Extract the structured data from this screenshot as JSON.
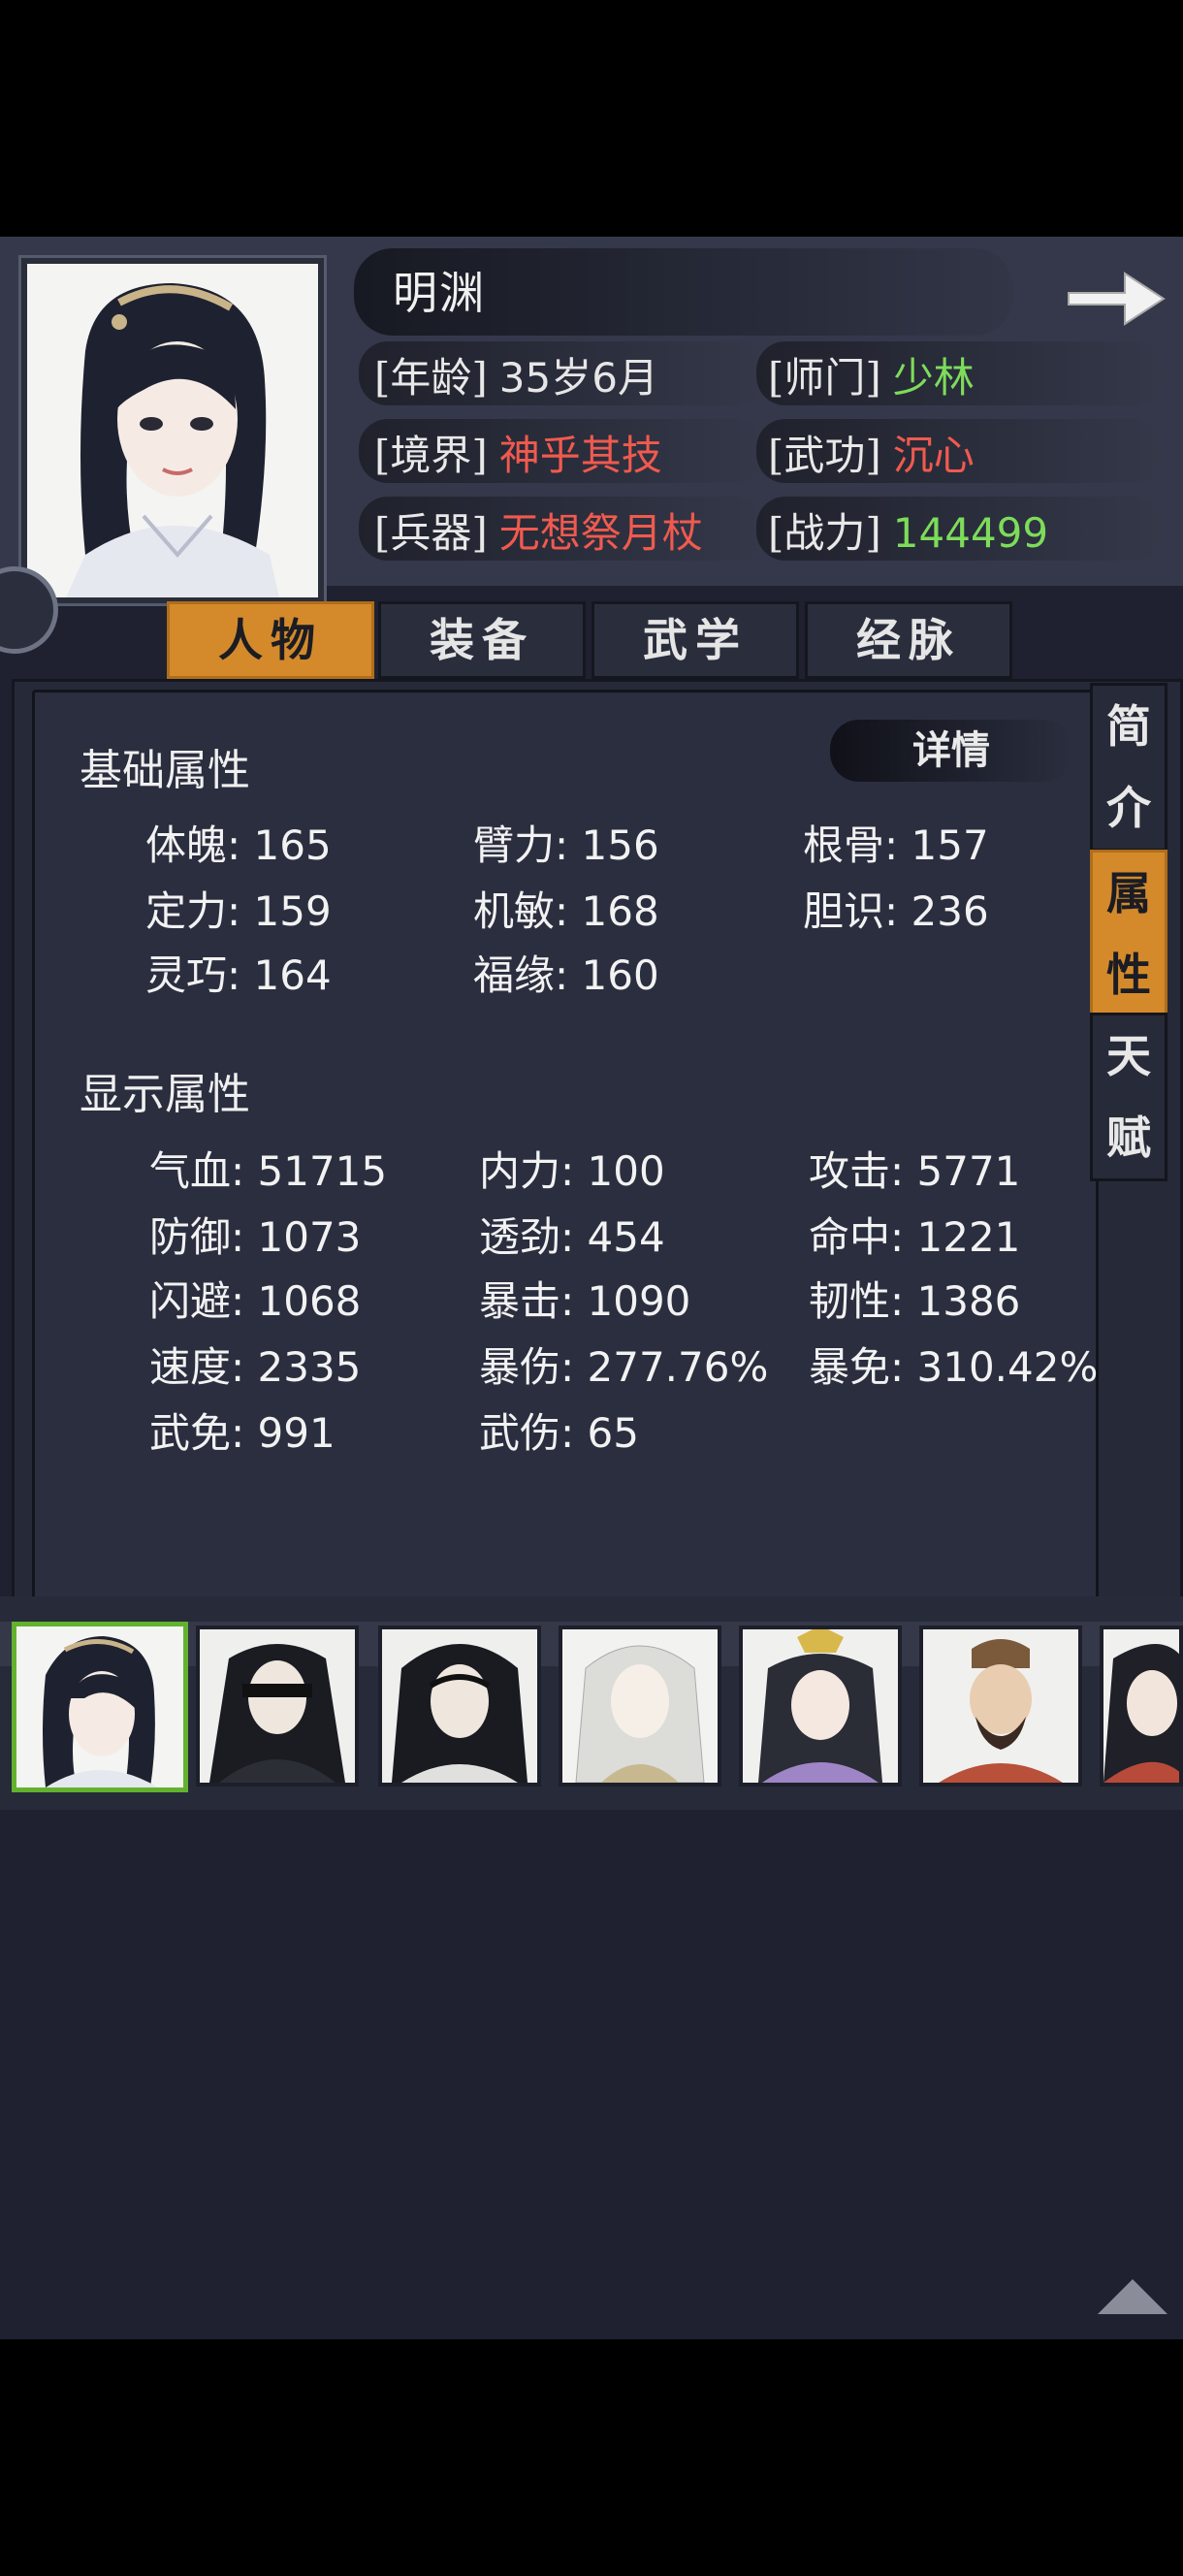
{
  "character": {
    "name": "明渊",
    "age_label": "[年龄]",
    "age_value": "35岁6月",
    "sect_label": "[师门]",
    "sect_value": "少林",
    "realm_label": "[境界]",
    "realm_value": "神乎其技",
    "martial_label": "[武功]",
    "martial_value": "沉心",
    "weapon_label": "[兵器]",
    "weapon_value": "无想祭月杖",
    "power_label": "[战力]",
    "power_value": "144499"
  },
  "colors": {
    "value_white": "#e6e6e6",
    "value_green": "#7ddc5a",
    "value_red": "#f05a4e",
    "accent_orange": "#d48a2a",
    "selected_border": "#63b22f"
  },
  "tabs": [
    "人物",
    "装备",
    "武学",
    "经脉"
  ],
  "active_tab": "人物",
  "side_tabs": [
    {
      "line1": "简",
      "line2": "介"
    },
    {
      "line1": "属",
      "line2": "性"
    },
    {
      "line1": "天",
      "line2": "赋"
    }
  ],
  "active_side_tab": "属性",
  "detail_button": "详情",
  "base_attributes": {
    "title": "基础属性",
    "items": [
      "体魄: 165",
      "臂力: 156",
      "根骨: 157",
      "定力: 159",
      "机敏: 168",
      "胆识: 236",
      "灵巧: 164",
      "福缘: 160"
    ]
  },
  "display_attributes": {
    "title": "显示属性",
    "items": [
      "气血: 51715",
      "内力: 100",
      "攻击: 5771",
      "防御: 1073",
      "透劲: 454",
      "命中: 1221",
      "闪避: 1068",
      "暴击: 1090",
      "韧性: 1386",
      "速度: 2335",
      "暴伤: 277.76%",
      "暴免: 310.42%",
      "武免: 991",
      "武伤: 65"
    ]
  },
  "roster": {
    "count": 7,
    "selected_index": 0,
    "icon_names": [
      "portrait-heroine-icon",
      "portrait-blindfolded-swordsman-icon",
      "portrait-long-hair-swordsman-icon",
      "portrait-white-hair-woman-icon",
      "portrait-crowned-woman-icon",
      "portrait-bearded-general-icon",
      "portrait-partial-icon"
    ]
  },
  "icons": {
    "next": "arrow-right-icon",
    "scroll_top": "triangle-up-icon",
    "left_ornament": "ring-ornament-icon"
  }
}
